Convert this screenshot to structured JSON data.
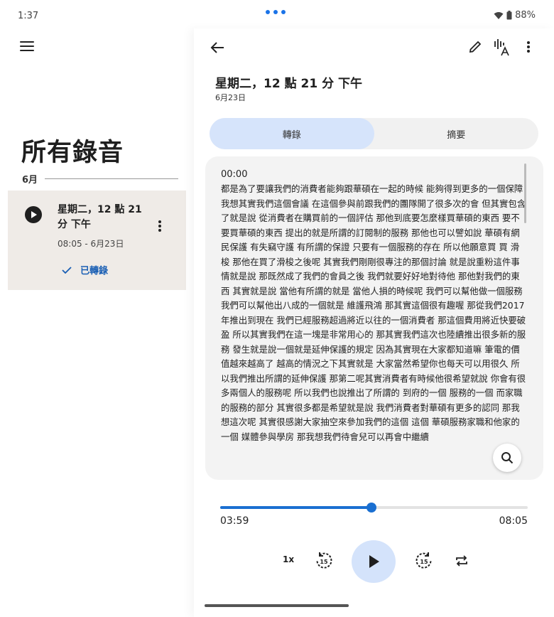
{
  "status_bar": {
    "time": "1:37",
    "battery": "88%"
  },
  "left_pane": {
    "title": "所有錄音",
    "month": "6月",
    "recording": {
      "title": "星期二，12 點 21 分 下午",
      "date": "08:05 - 6月23日",
      "status": "已轉錄"
    }
  },
  "detail": {
    "title": "星期二，12 點 21 分 下午",
    "date": "6月23日",
    "tabs": [
      "轉錄",
      "摘要"
    ],
    "active_tab": 0,
    "timestamp": "00:00",
    "transcript": "都是為了要讓我們的消費者能夠跟華碩在一起的時候 能夠得到更多的一個保障 我想其實我們這個會議 在這個參與前跟我們的團隊開了很多次的會 但其實包含了就是說 從消費者在購買前的一個評估 那他到底要怎麼樣買華碩的東西 要不要買華碩的東西 提出的就是所謂的訂閱制的服務 那他也可以譬如說 華碩有網民保護 有失竊守護 有所謂的保證 只要有一個服務的存在 所以他願意買 買 滑梭 那他在買了滑梭之後呢 其實我們剛剛很專注的那個討論 就是說重粉這件事情就是說 那既然成了我們的會員之後 我們就要好好地對待他 那他對我們的東西 其實就是說 當他有所謂的就是 當他人損的時候呢 我們可以幫他做一個服務 我們可以幫他出八成的一個就是 維護飛鴻 那其實這個很有趣喔 那從我們2017年推出到現在 我們已經服務超過將近以往的一個消費者 那這個費用將近快要破盈 所以其實我們在這一塊是非常用心的 那其實我們這次也陸續推出很多新的服務 發生就是說一個就是延伸保護的規定 因為其實現在大家都知道嘛 筆電的價值越來越高了 越高的情況之下其實就是 大家當然希望你也每天可以用很久 所以我們推出所謂的延伸保護 那第二呢其實消費者有時候他很希望就說 你會有很多兩個人的服務呢 所以我們也說推出了所謂的 到府的一個 服務的一個 而家職的服務的部分 其實很多都是希望就是說 我們消費者對華碩有更多的認同 那我想這次呢 其實很感謝大家抽空來參加我們的這個 這個 華碩服務家職和他家的一個 媒體參與學房 那我想我們待會兒可以再會中繼續"
  },
  "player": {
    "current_time": "03:59",
    "total_time": "08:05",
    "progress": 0.493,
    "speed": "1x",
    "skip_back": "15",
    "skip_forward": "15"
  },
  "colors": {
    "accent": "#1a6fd1",
    "card_bg": "#efebe7",
    "tab_active": "#d6e4fb"
  }
}
